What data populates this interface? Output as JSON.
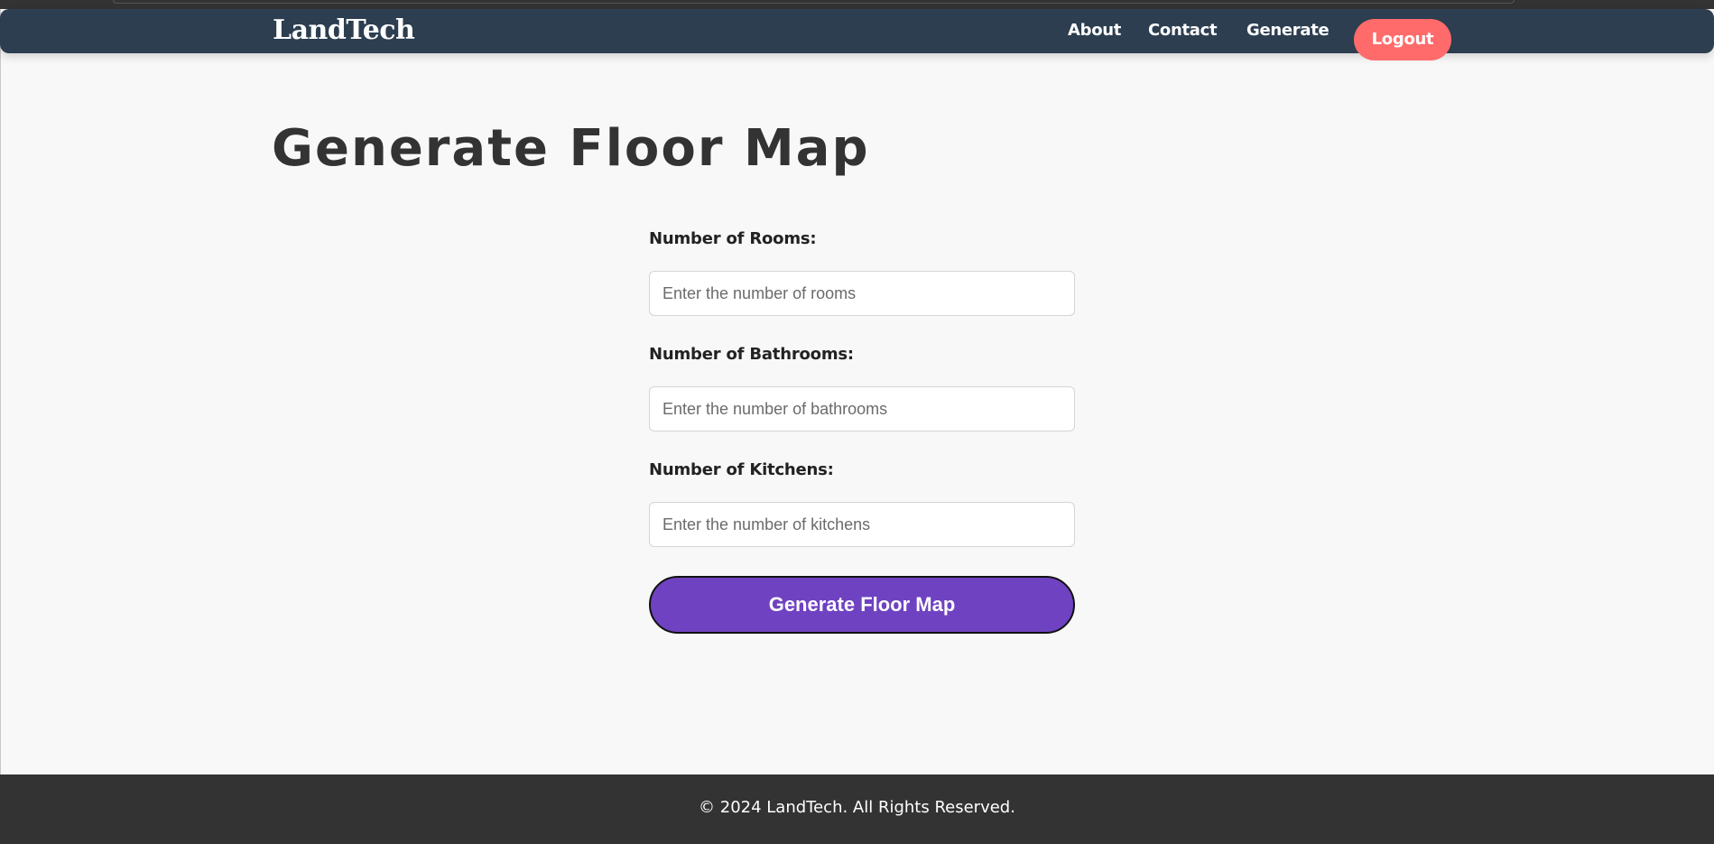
{
  "navbar": {
    "brand": "LandTech",
    "links": {
      "about": "About",
      "contact": "Contact",
      "generate": "Generate"
    },
    "logout_label": "Logout"
  },
  "main": {
    "title": "Generate Floor Map",
    "form": {
      "rooms": {
        "label": "Number of Rooms:",
        "placeholder": "Enter the number of rooms"
      },
      "bathrooms": {
        "label": "Number of Bathrooms:",
        "placeholder": "Enter the number of bathrooms"
      },
      "kitchens": {
        "label": "Number of Kitchens:",
        "placeholder": "Enter the number of kitchens"
      },
      "submit_label": "Generate Floor Map"
    }
  },
  "footer": {
    "text": "© 2024 LandTech. All Rights Reserved."
  },
  "colors": {
    "navbar_bg": "#2c3e50",
    "logout_bg": "#ff6b6b",
    "submit_bg": "#6f42c1",
    "page_bg": "#f8f8f8",
    "footer_bg": "#333333"
  }
}
